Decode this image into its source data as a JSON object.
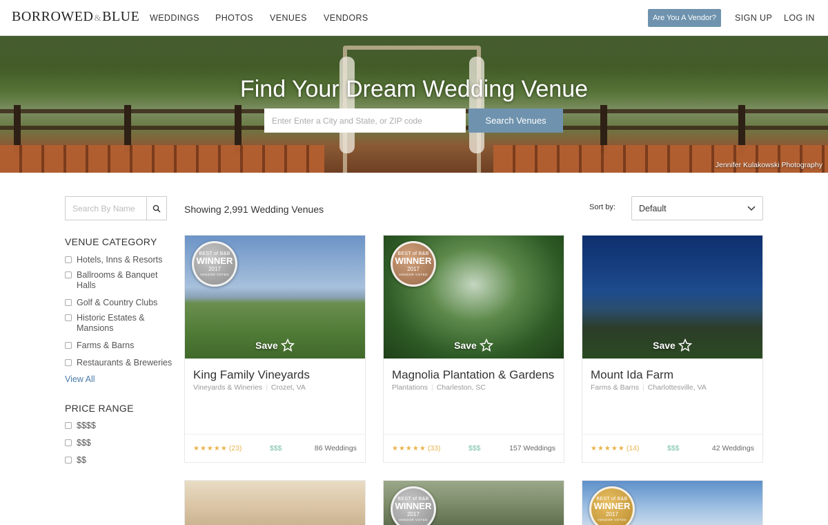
{
  "header": {
    "logo_main": "BORROWED",
    "logo_amp": "&",
    "logo_end": "BLUE",
    "nav": [
      "WEDDINGS",
      "PHOTOS",
      "VENUES",
      "VENDORS"
    ],
    "vendor_button": "Are You A Vendor?",
    "signup": "SIGN UP",
    "login": "LOG IN"
  },
  "hero": {
    "title": "Find Your Dream Wedding Venue",
    "search_placeholder": "Enter Enter a City and State, or ZIP code",
    "search_button": "Search Venues",
    "credit": "Jennifer Kulakowski Photography"
  },
  "sidebar": {
    "search_placeholder": "Search By Name",
    "venue_category_heading": "VENUE CATEGORY",
    "categories": [
      "Hotels, Inns & Resorts",
      "Ballrooms & Banquet Halls",
      "Golf & Country Clubs",
      "Historic Estates & Mansions",
      "Farms & Barns",
      "Restaurants & Breweries"
    ],
    "view_all": "View All",
    "price_heading": "PRICE RANGE",
    "prices": [
      "$$$$",
      "$$$",
      "$$"
    ]
  },
  "listing": {
    "showing": "Showing 2,991 Wedding Venues",
    "sort_label": "Sort by:",
    "sort_value": "Default",
    "save_label": "Save",
    "badge": {
      "line1": "BEST of B&B",
      "line2": "WINNER",
      "line3": "2017",
      "line4": "VENDOR VOTED"
    },
    "venues": [
      {
        "name": "King Family Vineyards",
        "category": "Vineyards & Wineries",
        "location": "Crozet, VA",
        "stars": "★★★★★",
        "reviews": "(23)",
        "price": "$$$",
        "weddings": "86 Weddings"
      },
      {
        "name": "Magnolia Plantation & Gardens",
        "category": "Plantations",
        "location": "Charleston, SC",
        "stars": "★★★★★",
        "reviews": "(33)",
        "price": "$$$",
        "weddings": "157 Weddings"
      },
      {
        "name": "Mount Ida Farm",
        "category": "Farms & Barns",
        "location": "Charlottesville, VA",
        "stars": "★★★★★",
        "reviews": "(14)",
        "price": "$$$",
        "weddings": "42 Weddings"
      }
    ]
  }
}
